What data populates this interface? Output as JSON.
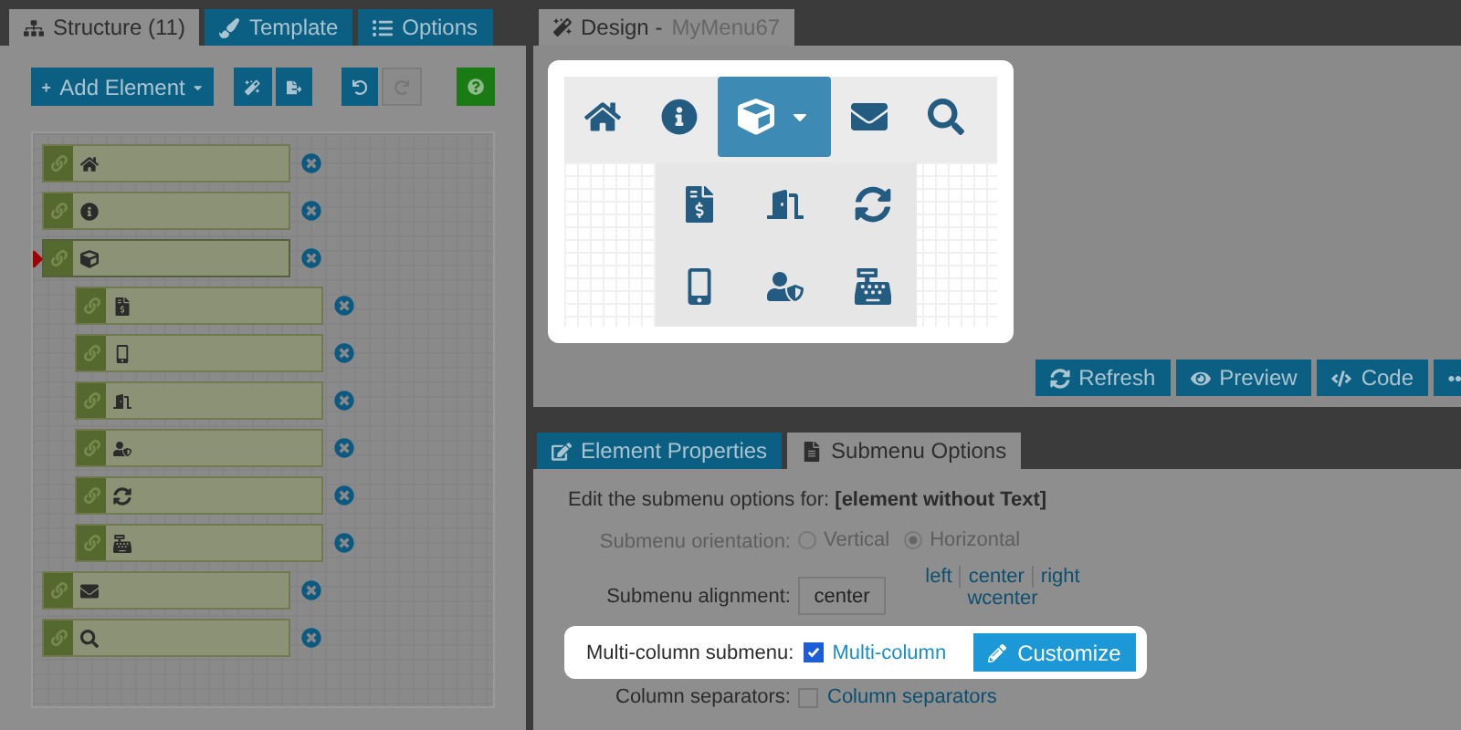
{
  "structure_tabs": [
    {
      "label": "Structure (11)",
      "kind": "sitemap",
      "selected": true
    },
    {
      "label": "Template",
      "kind": "brush",
      "selected": false
    },
    {
      "label": "Options",
      "kind": "list",
      "selected": false
    }
  ],
  "toolbar": {
    "add_button": "Add Element",
    "redo_disabled": true
  },
  "tree": [
    {
      "kind": "home",
      "selected": false
    },
    {
      "kind": "info",
      "selected": false
    },
    {
      "kind": "cube",
      "selected": true,
      "children": [
        {
          "kind": "invoice",
          "selected": false
        },
        {
          "kind": "mobile",
          "selected": false
        },
        {
          "kind": "hanger",
          "selected": false
        },
        {
          "kind": "usershield",
          "selected": false
        },
        {
          "kind": "exchange",
          "selected": false
        },
        {
          "kind": "register",
          "selected": false
        }
      ]
    },
    {
      "kind": "mail",
      "selected": false
    },
    {
      "kind": "search",
      "selected": false
    }
  ],
  "design_tab": {
    "label": "Design -",
    "menu_name": "MyMenu67"
  },
  "preview_menu": [
    {
      "kind": "home",
      "selected": false
    },
    {
      "kind": "info",
      "selected": false
    },
    {
      "kind": "cube",
      "selected": true
    },
    {
      "kind": "mail",
      "selected": false
    },
    {
      "kind": "search",
      "selected": false
    }
  ],
  "preview_submenu": [
    {
      "kind": "invoice"
    },
    {
      "kind": "hanger"
    },
    {
      "kind": "exchange"
    },
    {
      "kind": "mobile"
    },
    {
      "kind": "usershield"
    },
    {
      "kind": "register"
    }
  ],
  "design_buttons": [
    {
      "label": "Refresh",
      "kind": "refresh"
    },
    {
      "label": "Preview",
      "kind": "preview"
    },
    {
      "label": "Code",
      "kind": "code"
    },
    {
      "kind": "more"
    }
  ],
  "bottom_tabs": [
    {
      "label": "Element Properties",
      "kind": "edit",
      "selected": false
    },
    {
      "label": "Submenu Options",
      "kind": "doc",
      "selected": true
    }
  ],
  "intro": "Edit the submenu options for: **[element without Text]**",
  "orientation": {
    "label": "Submenu orientation:",
    "disabled": true,
    "options": [
      {
        "label": "Vertical",
        "selected": false
      },
      {
        "label": "Horizontal",
        "selected": true
      }
    ]
  },
  "alignment": {
    "label": "Submenu alignment:",
    "value": "center",
    "links": [
      "left",
      "center",
      "right",
      "wcenter"
    ]
  },
  "multi_column": {
    "label": "Multi-column submenu:",
    "checked": true,
    "text": "Multi-column",
    "button": "Customize"
  },
  "separators": {
    "label": "Column separators:",
    "checked": false,
    "text": "Column separators"
  }
}
